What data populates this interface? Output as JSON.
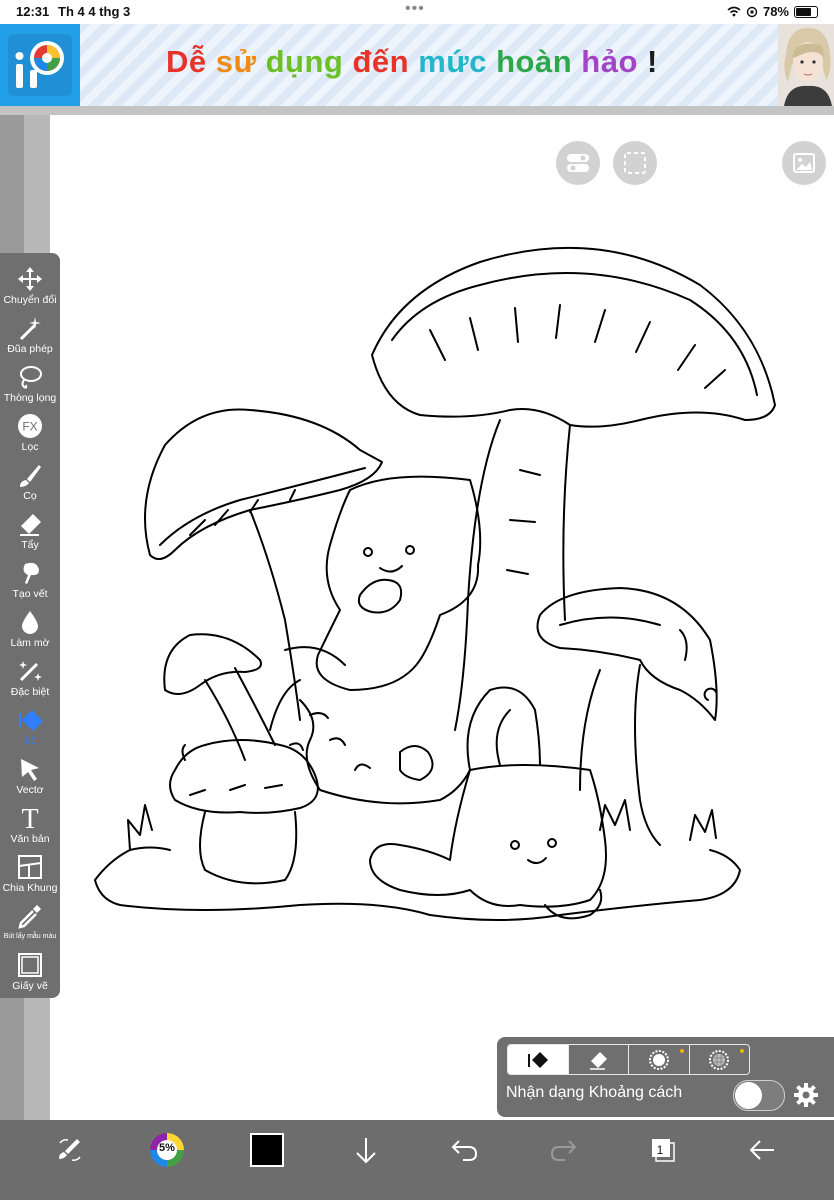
{
  "status": {
    "time": "12:31",
    "date": "Th 4 4 thg 3",
    "battery": "78%"
  },
  "banner": {
    "logo_text": "iP",
    "words": [
      {
        "text": "Dễ",
        "color": "#e8332b"
      },
      {
        "text": "sử",
        "color": "#f08a17"
      },
      {
        "text": "dụng",
        "color": "#6bbf27"
      },
      {
        "text": "đến",
        "color": "#e8332b"
      },
      {
        "text": "mức",
        "color": "#22b7c9"
      },
      {
        "text": "hoàn",
        "color": "#2ea84a"
      },
      {
        "text": "hảo",
        "color": "#a443c8"
      },
      {
        "text": "!",
        "color": "#1b1b1b"
      }
    ]
  },
  "toolbar": {
    "tools": [
      {
        "label": "Chuyển đổi",
        "icon": "move-arrows-icon"
      },
      {
        "label": "Đũa phép",
        "icon": "magic-wand-icon"
      },
      {
        "label": "Thòng lọng",
        "icon": "lasso-icon"
      },
      {
        "label": "Lọc",
        "icon": "fx-filter-icon"
      },
      {
        "label": "Cọ",
        "icon": "brush-icon"
      },
      {
        "label": "Tẩy",
        "icon": "eraser-icon"
      },
      {
        "label": "Tạo vết",
        "icon": "smudge-icon"
      },
      {
        "label": "Làm mờ",
        "icon": "blur-drop-icon"
      },
      {
        "label": "Đặc biệt",
        "icon": "special-wand-icon"
      },
      {
        "label": "Xô",
        "icon": "bucket-fill-icon"
      },
      {
        "label": "Vectơ",
        "icon": "vector-cursor-icon"
      },
      {
        "label": "Văn bản",
        "icon": "text-icon"
      },
      {
        "label": "Chia Khung",
        "icon": "frame-divider-icon"
      },
      {
        "label": "Bút lấy mẫu màu",
        "icon": "eyedropper-icon"
      },
      {
        "label": "Giấy vẽ",
        "icon": "canvas-paper-icon"
      }
    ],
    "active": "Xô"
  },
  "fill_panel": {
    "modes": [
      "fill-mode-icon",
      "eraser-mode-icon",
      "circle-mode-icon",
      "pattern-circle-mode-icon"
    ],
    "label": "Nhận dạng Khoảng cách",
    "toggle_on": false
  },
  "bottombar": {
    "color_wheel_label": "5%",
    "current_color": "#000000",
    "layer_count": "1"
  },
  "colors": {
    "toolbar": "#6f6f6f",
    "active_tool": "#2f7fff",
    "accent_dot": "#f0b400"
  }
}
